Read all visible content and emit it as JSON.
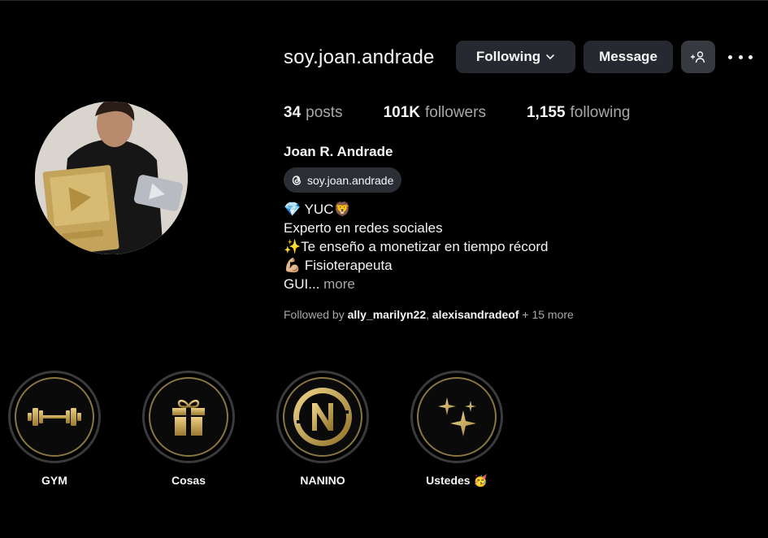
{
  "profile": {
    "username": "soy.joan.andrade",
    "full_name": "Joan R. Andrade",
    "threads_handle": "soy.joan.andrade",
    "posts_count": "34",
    "posts_label": "posts",
    "followers_count": "101K",
    "followers_label": "followers",
    "following_count": "1,155",
    "following_label": "following"
  },
  "buttons": {
    "following": "Following",
    "message": "Message"
  },
  "bio": {
    "line1": "💎 YUC🦁",
    "line2": "Experto en redes sociales",
    "line3": "✨Te enseño a monetizar en tiempo récord",
    "line4": "💪🏼 Fisioterapeuta",
    "line5": "GUI...",
    "more": "more"
  },
  "followed_by": {
    "prefix": "Followed by",
    "user1": "ally_marilyn22",
    "separator": ",",
    "user2": "alexisandradeof",
    "suffix": "+ 15 more"
  },
  "highlights": [
    {
      "label": "GYM",
      "icon": "dumbbell-icon"
    },
    {
      "label": "Cosas",
      "icon": "gift-icon"
    },
    {
      "label": "NANINO",
      "icon": "n-logo-icon"
    },
    {
      "label": "Ustedes 🥳",
      "icon": "sparkles-icon"
    }
  ],
  "colors": {
    "background": "#000000",
    "button": "#262a30",
    "gold": "#c9a84c",
    "muted_text": "#a8a8a8"
  }
}
